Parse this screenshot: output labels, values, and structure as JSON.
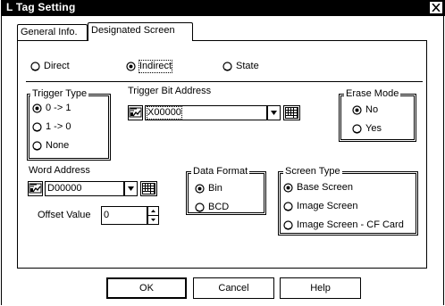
{
  "window": {
    "title": "L Tag Setting"
  },
  "tabs": [
    {
      "label": "General Info.",
      "active": false
    },
    {
      "label": "Designated Screen",
      "active": true
    }
  ],
  "mode": {
    "options": [
      "Direct",
      "Indirect",
      "State"
    ],
    "selected": "Indirect"
  },
  "trigger_type": {
    "title": "Trigger Type",
    "options": [
      "0 -> 1",
      "1 -> 0",
      "None"
    ],
    "selected": "0 -> 1"
  },
  "trigger_bit_address": {
    "label": "Trigger Bit Address",
    "value": "X00000"
  },
  "erase_mode": {
    "title": "Erase Mode",
    "options": [
      "No",
      "Yes"
    ],
    "selected": "No"
  },
  "word_address": {
    "label": "Word Address",
    "value": "D00000"
  },
  "offset": {
    "label": "Offset Value",
    "value": "0"
  },
  "data_format": {
    "title": "Data Format",
    "options": [
      "Bin",
      "BCD"
    ],
    "selected": "Bin"
  },
  "screen_type": {
    "title": "Screen Type",
    "options": [
      "Base Screen",
      "Image Screen",
      "Image Screen - CF Card"
    ],
    "selected": "Base Screen"
  },
  "buttons": {
    "ok": "OK",
    "cancel": "Cancel",
    "help": "Help"
  },
  "icons": {
    "close": "close-icon",
    "address_picker": "address-picker-icon",
    "keypad": "keypad-icon",
    "dropdown": "chevron-down-icon",
    "spin_up": "spin-up-icon",
    "spin_down": "spin-down-icon"
  }
}
